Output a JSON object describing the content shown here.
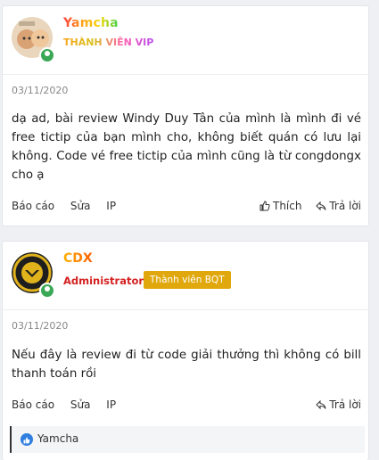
{
  "post1": {
    "username": "Yamcha",
    "user_title": "THÀNH VIÊN VIP",
    "date": "03/11/2020",
    "body": "dạ ad, bài review Windy Duy Tân của mình là mình đi vé free tictip của bạn mình cho, không biết quán có lưu lại không. Code vé free tictip của mình cũng là từ congdongx cho ạ",
    "actions_left": [
      "Báo cáo",
      "Sửa",
      "IP"
    ],
    "like_label": "Thích",
    "reply_label": "Trả lời"
  },
  "post2": {
    "username": "CDX",
    "role": "Administrator",
    "badge": "Thành viên BQT",
    "date": "03/11/2020",
    "body": "Nếu đây là review đi từ code giải thưởng thì không có bill thanh toán rồi",
    "actions_left": [
      "Báo cáo",
      "Sửa",
      "IP"
    ],
    "reply_label": "Trả lời",
    "reaction_user": "Yamcha"
  },
  "colors": {
    "online": "#3aa857",
    "badge": "#e0a80d",
    "role": "#d42121",
    "like": "#2f7ee0"
  }
}
